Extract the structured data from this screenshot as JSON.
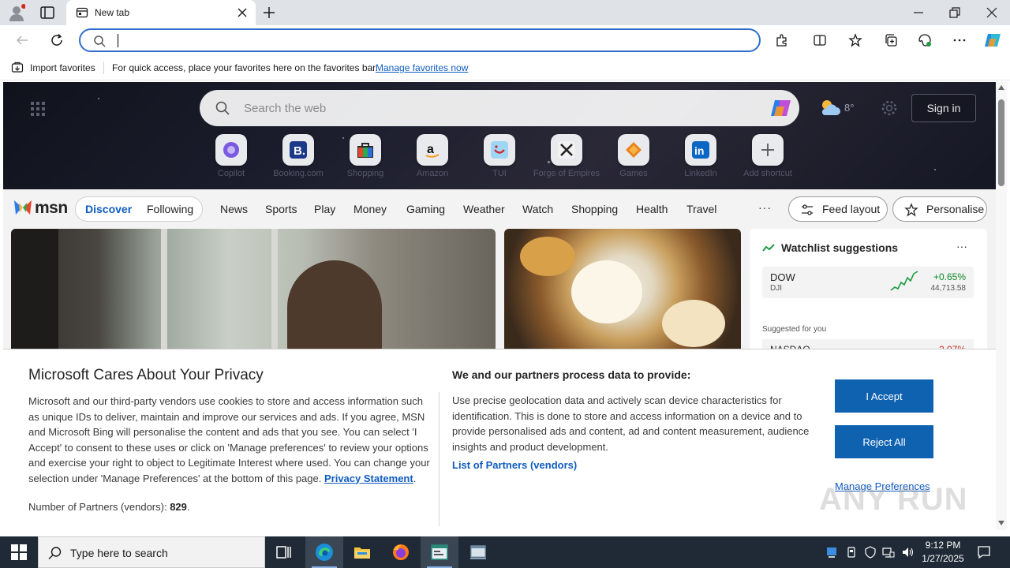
{
  "browser": {
    "tab_title": "New tab",
    "address_value": "",
    "favorites_bar": {
      "import_label": "Import favorites",
      "message": "For quick access, place your favorites here on the favorites bar.",
      "manage_link": "Manage favorites now"
    }
  },
  "hero": {
    "search_placeholder": "Search the web",
    "weather_temp": "8°",
    "sign_in_label": "Sign in",
    "quick_links": [
      {
        "icon": "copilot-app-icon",
        "label": "Copilot"
      },
      {
        "icon": "booking-icon",
        "label": "Booking.com"
      },
      {
        "icon": "shopping-bag-icon",
        "label": "Shopping"
      },
      {
        "icon": "amazon-icon",
        "label": "Amazon"
      },
      {
        "icon": "tui-icon",
        "label": "TUI"
      },
      {
        "icon": "forge-of-empires-icon",
        "label": "Forge of Empires"
      },
      {
        "icon": "game-icon",
        "label": "Games"
      },
      {
        "icon": "linkedin-icon",
        "label": "LinkedIn"
      },
      {
        "icon": "add-icon",
        "label": "Add shortcut"
      }
    ]
  },
  "msn": {
    "logo_text": "msn",
    "discover_label": "Discover",
    "following_label": "Following",
    "categories": [
      "News",
      "Sports",
      "Play",
      "Money",
      "Gaming",
      "Weather",
      "Watch",
      "Shopping",
      "Health",
      "Travel"
    ],
    "more_label": "···",
    "feed_layout_label": "Feed layout",
    "personalise_label": "Personalise"
  },
  "watchlist": {
    "title": "Watchlist suggestions",
    "more_label": "···",
    "stock": {
      "symbol": "DOW",
      "sub": "DJI",
      "change": "+0.65%",
      "value": "44,713.58"
    },
    "suggested_label": "Suggested for you",
    "second_stock": {
      "symbol": "NASDAQ",
      "change": "-2.07%"
    }
  },
  "privacy": {
    "title": "Microsoft Cares About Your Privacy",
    "body": "Microsoft and our third-party vendors use cookies to store and access information such as unique IDs to deliver, maintain and improve our services and ads. If you agree, MSN and Microsoft Bing will personalise the content and ads that you see. You can select 'I Accept' to consent to these uses or click on 'Manage preferences' to review your options and exercise your right to object to Legitimate Interest where used.  You can change your selection under 'Manage Preferences' at the bottom of this page.",
    "privacy_link": "Privacy Statement",
    "partners_label": "Number of Partners (vendors):",
    "partners_count": "829",
    "right_title": "We and our partners process data to provide:",
    "right_body": "Use precise geolocation data and actively scan device characteristics for identification. This is done to store and access information on a device and to provide personalised ads and content, ad and content measurement, audience insights and product development.",
    "partners_link": "List of Partners (vendors)",
    "accept_label": "I Accept",
    "reject_label": "Reject All",
    "manage_label": "Manage Preferences"
  },
  "watermark": "ANY RUN",
  "taskbar": {
    "search_placeholder": "Type here to search",
    "time": "9:12 PM",
    "date": "1/27/2025"
  }
}
